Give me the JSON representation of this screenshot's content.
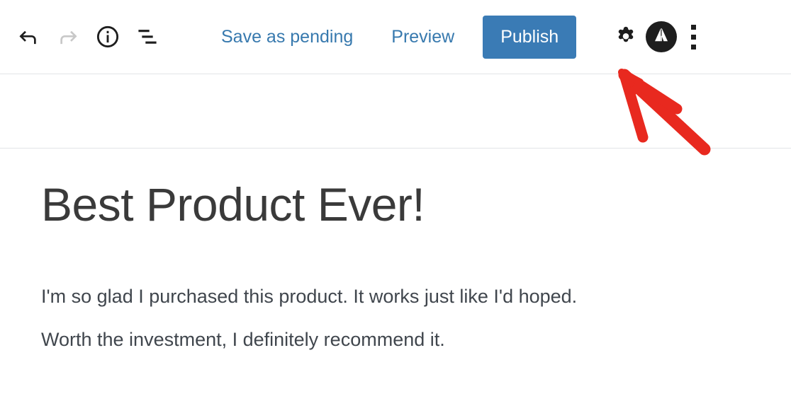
{
  "toolbar": {
    "undo": {
      "label": "Undo",
      "icon": "undo-arrow-icon",
      "state": "enabled",
      "color": "#1e1e1e"
    },
    "redo": {
      "label": "Redo",
      "icon": "redo-arrow-icon",
      "state": "disabled",
      "color": "#c8c8c8"
    },
    "details": {
      "label": "Details",
      "icon": "info-circle-icon",
      "color": "#1e1e1e"
    },
    "list_view": {
      "label": "List view",
      "icon": "list-view-icon",
      "color": "#1e1e1e"
    },
    "save_pending_label": "Save as pending",
    "preview_label": "Preview",
    "publish_label": "Publish",
    "settings": {
      "label": "Settings",
      "icon": "gear-icon",
      "color": "#1e1e1e"
    },
    "avatar": {
      "label": "Account",
      "icon": "jetpack-a-logo-icon",
      "color": "#1e1e1e"
    },
    "more_options": {
      "label": "Options",
      "icon": "three-dots-vertical-icon",
      "color": "#1e1e1e"
    }
  },
  "colors": {
    "link_blue": "#3779ae",
    "publish_blue": "#3a7bb5",
    "annotation_red": "#e8291f",
    "divider": "#e2e4e7",
    "title_text": "#3a3a3a",
    "body_text": "#40464d",
    "background": "#ffffff"
  },
  "post": {
    "title": "Best Product Ever!",
    "paragraphs": [
      "I'm so glad I purchased this product. It works just like I'd hoped.",
      "Worth the investment, I definitely recommend it."
    ]
  },
  "annotation": {
    "type": "hand-drawn-arrow",
    "direction": "up-left",
    "points_to": "publish-button",
    "color": "#e8291f"
  }
}
